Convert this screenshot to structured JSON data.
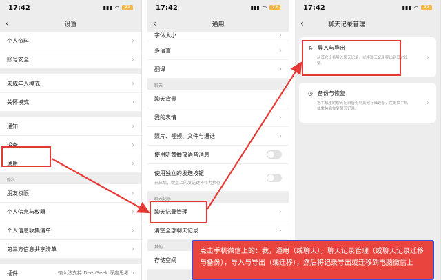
{
  "status": {
    "time": "17:42",
    "battery": "72"
  },
  "screen1": {
    "title": "设置",
    "rows_a": [
      "个人资料",
      "账号安全"
    ],
    "rows_b": [
      "未成年人模式",
      "关怀模式"
    ],
    "rows_c": [
      "通知",
      "设备",
      "通用"
    ],
    "section_privacy": "隐私",
    "rows_d": [
      "朋友权限",
      "个人信息与权限",
      "个人信息收集清单",
      "第三方信息共享清单"
    ],
    "plugin_label": "插件",
    "plugin_value": "输入法支持 DeepSeek 深度思考"
  },
  "screen2": {
    "title": "通用",
    "rows_a": [
      "字体大小",
      "多语言",
      "翻译"
    ],
    "section_chat": "聊天",
    "rows_b": [
      "聊天背景",
      "我的表情",
      "照片、视频、文件与通话"
    ],
    "toggle1": "使用听筒播放语音消息",
    "toggle2": "使用独立的发送按钮",
    "toggle2_sub": "开启后，键盘上的发送键将作为换行",
    "section_history": "聊天记录",
    "rows_c": [
      "聊天记录管理",
      "清空全部聊天记录"
    ],
    "section_other": "其他",
    "rows_d": [
      "存储空间"
    ]
  },
  "screen3": {
    "title": "聊天记录管理",
    "card1_title": "导入与导出",
    "card1_desc": "从其它设备导入聊天记录，或将聊天记录导出到其它设备。",
    "card2_title": "备份与恢复",
    "card2_desc": "把手机里的聊天记录备份到其他存储设备，在更换手机或重装后恢复聊天记录。"
  },
  "note_text": "点击手机微信上的：我，通用（或聊天），聊天记录管理（或聊天记录迁移与备份），导入与导出（或迁移），然后将记录导出或迁移到电脑微信上",
  "colors": {
    "highlight": "#e53935",
    "note_bg": "#e9453e",
    "note_border": "#3c4ad6"
  }
}
